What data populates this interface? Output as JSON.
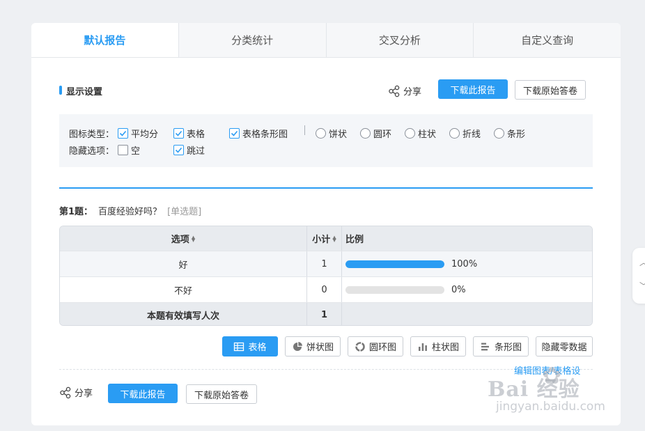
{
  "tabs": [
    {
      "label": "默认报告",
      "active": true
    },
    {
      "label": "分类统计",
      "active": false
    },
    {
      "label": "交叉分析",
      "active": false
    },
    {
      "label": "自定义查询",
      "active": false
    }
  ],
  "display_settings": {
    "title": "显示设置",
    "share_label": "分享",
    "download_report": "下载此报告",
    "download_raw": "下载原始答卷"
  },
  "settings": {
    "chart_type_label": "图标类型：",
    "chart_type_options": [
      {
        "label": "平均分",
        "checked": true,
        "kind": "checkbox"
      },
      {
        "label": "表格",
        "checked": true,
        "kind": "checkbox"
      },
      {
        "label": "表格条形图",
        "checked": true,
        "kind": "checkbox"
      },
      {
        "label": "饼状",
        "checked": false,
        "kind": "radio"
      },
      {
        "label": "圆环",
        "checked": false,
        "kind": "radio"
      },
      {
        "label": "柱状",
        "checked": false,
        "kind": "radio"
      },
      {
        "label": "折线",
        "checked": false,
        "kind": "radio"
      },
      {
        "label": "条形",
        "checked": false,
        "kind": "radio"
      }
    ],
    "hide_label": "隐藏选项：",
    "hide_options": [
      {
        "label": "空",
        "checked": false
      },
      {
        "label": "跳过",
        "checked": true
      }
    ]
  },
  "question": {
    "number": "第1题：",
    "text": "百度经验好吗？",
    "type": "[单选题]"
  },
  "table": {
    "headers": {
      "option": "选项",
      "subtotal": "小计",
      "ratio": "比例"
    },
    "rows": [
      {
        "option": "好",
        "count": "1",
        "percent_text": "100%",
        "fraction": 1.0
      },
      {
        "option": "不好",
        "count": "0",
        "percent_text": "0%",
        "fraction": 0.0
      }
    ],
    "total": {
      "label": "本题有效填写人次",
      "count": "1"
    }
  },
  "view_buttons": [
    {
      "label": "表格",
      "icon": "table-icon",
      "active": true
    },
    {
      "label": "饼状图",
      "icon": "pie-icon",
      "active": false
    },
    {
      "label": "圆环图",
      "icon": "donut-icon",
      "active": false
    },
    {
      "label": "柱状图",
      "icon": "column-icon",
      "active": false
    },
    {
      "label": "条形图",
      "icon": "bar-icon",
      "active": false
    },
    {
      "label": "隐藏零数据",
      "icon": "",
      "active": false
    }
  ],
  "footer": {
    "share_label": "分享",
    "download_report": "下载此报告",
    "download_raw": "下载原始答卷",
    "edit_link": "编辑图表/表格设"
  },
  "watermark": {
    "logo": "Bai 经验",
    "url": "jingyan.baidu.com"
  },
  "colors": {
    "accent": "#2a9cf3",
    "background": "#eef0f3",
    "panel": "#f4f6f9"
  }
}
